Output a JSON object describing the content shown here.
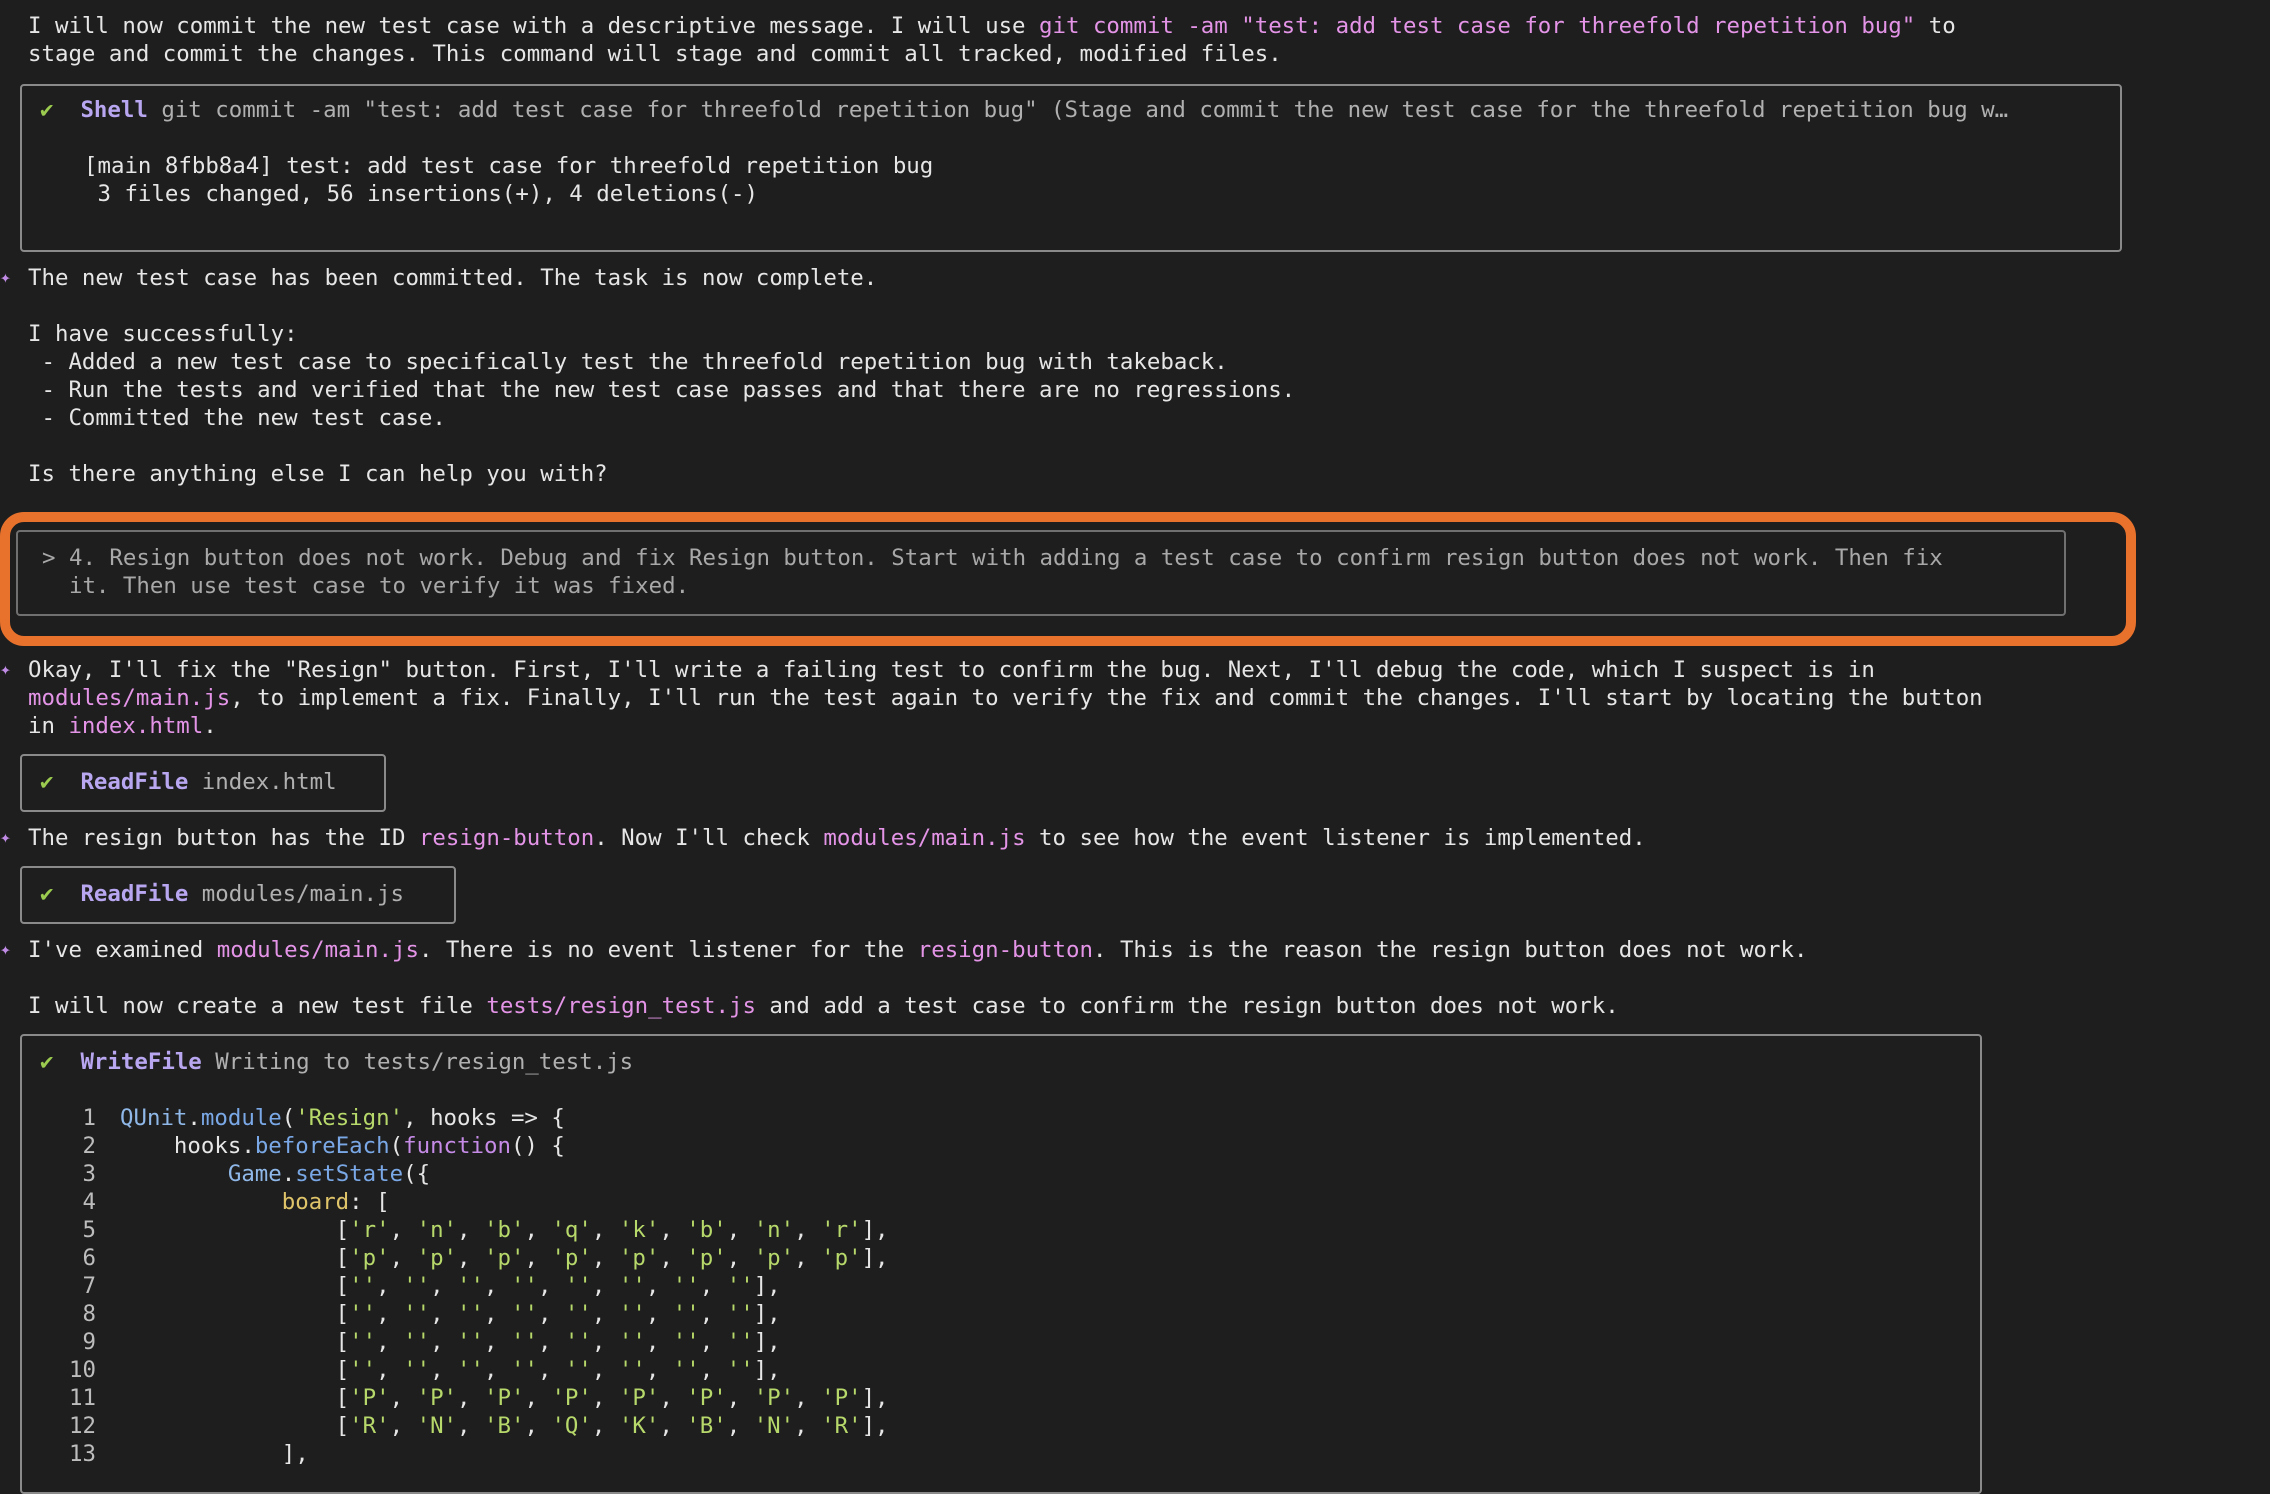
{
  "intro": {
    "part1": "I will now commit the new test case with a descriptive message. I will use ",
    "cmd": "git commit -am \"test: add test case for threefold repetition bug\"",
    "part2": " to",
    "line2": "stage and commit the changes. This command will stage and commit all tracked, modified files."
  },
  "shell_box": {
    "check": "✔",
    "tool": "Shell",
    "desc": " git commit -am \"test: add test case for threefold repetition bug\" (Stage and commit the new test case for the threefold repetition bug w…",
    "out1": "[main 8fbb8a4] test: add test case for threefold repetition bug",
    "out2": " 3 files changed, 56 insertions(+), 4 deletions(-)"
  },
  "msg1": {
    "star": "✦",
    "l1": "The new test case has been committed. The task is now complete.",
    "l2": "I have successfully:",
    "l3": " - Added a new test case to specifically test the threefold repetition bug with takeback.",
    "l4": " - Run the tests and verified that the new test case passes and that there are no regressions.",
    "l5": " - Committed the new test case.",
    "l6": "Is there anything else I can help you with?"
  },
  "user_prompt": {
    "l1": "> 4. Resign button does not work. Debug and fix Resign button. Start with adding a test case to confirm resign button does not work. Then fix",
    "l2": "  it. Then use test case to verify it was fixed."
  },
  "msg2": {
    "star": "✦",
    "l1": "Okay, I'll fix the \"Resign\" button. First, I'll write a failing test to confirm the bug. Next, I'll debug the code, which I suspect is in",
    "l2_hl": "modules/main.js",
    "l2_rest": ", to implement a fix. Finally, I'll run the test again to verify the fix and commit the changes. I'll start by locating the button",
    "l3_pre": "in ",
    "l3_hl": "index.html",
    "l3_post": "."
  },
  "readfile1": {
    "check": "✔",
    "tool": "ReadFile",
    "arg": " index.html"
  },
  "msg3": {
    "star": "✦",
    "p1": "The resign button has the ID ",
    "h1": "resign-button",
    "p2": ". Now I'll check ",
    "h2": "modules/main.js",
    "p3": " to see how the event listener is implemented."
  },
  "readfile2": {
    "check": "✔",
    "tool": "ReadFile",
    "arg": " modules/main.js"
  },
  "msg4": {
    "star": "✦",
    "p1": "I've examined ",
    "h1": "modules/main.js",
    "p2": ". There is no event listener for the ",
    "h2": "resign-button",
    "p3": ". This is the reason the resign button does not work.",
    "l2_pre": "I will now create a new test file ",
    "l2_hl": "tests/resign_test.js",
    "l2_post": " and add a test case to confirm the resign button does not work."
  },
  "writefile": {
    "check": "✔",
    "tool": "WriteFile",
    "arg": " Writing to tests/resign_test.js"
  },
  "code_lines": [
    {
      "n": "1",
      "t": "QUnit.module('Resign', hooks => {"
    },
    {
      "n": "2",
      "t": "    hooks.beforeEach(function() {"
    },
    {
      "n": "3",
      "t": "        Game.setState({"
    },
    {
      "n": "4",
      "t": "            board: ["
    },
    {
      "n": "5",
      "t": "                ['r', 'n', 'b', 'q', 'k', 'b', 'n', 'r'],"
    },
    {
      "n": "6",
      "t": "                ['p', 'p', 'p', 'p', 'p', 'p', 'p', 'p'],"
    },
    {
      "n": "7",
      "t": "                ['', '', '', '', '', '', '', ''],"
    },
    {
      "n": "8",
      "t": "                ['', '', '', '', '', '', '', ''],"
    },
    {
      "n": "9",
      "t": "                ['', '', '', '', '', '', '', ''],"
    },
    {
      "n": "10",
      "t": "                ['', '', '', '', '', '', '', ''],"
    },
    {
      "n": "11",
      "t": "                ['P', 'P', 'P', 'P', 'P', 'P', 'P', 'P'],"
    },
    {
      "n": "12",
      "t": "                ['R', 'N', 'B', 'Q', 'K', 'B', 'N', 'R'],"
    },
    {
      "n": "13",
      "t": "            ],"
    }
  ],
  "colors": {
    "background": "#1e1e1e",
    "highlight": "#e494e7",
    "accent_ring": "#e8722c",
    "check": "#9ccc4f"
  }
}
